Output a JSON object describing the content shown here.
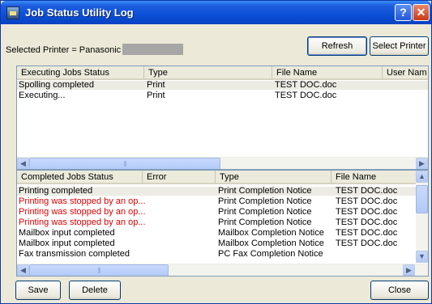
{
  "window": {
    "title": "Job Status Utility Log",
    "help_glyph": "?",
    "close_glyph": "✕"
  },
  "printer": {
    "label": "Selected Printer = Panasonic"
  },
  "buttons": {
    "refresh": "Refresh",
    "select_printer": "Select Printer",
    "save": "Save",
    "delete": "Delete",
    "close": "Close"
  },
  "executing": {
    "columns": [
      "Executing Jobs Status",
      "Type",
      "File Name",
      "User Nam"
    ],
    "rows": [
      [
        "Spolling completed",
        "Print",
        "TEST DOC.doc",
        ""
      ],
      [
        "Executing...",
        "Print",
        "TEST DOC.doc",
        ""
      ]
    ]
  },
  "completed": {
    "columns": [
      "Completed Jobs Status",
      "Error",
      "Type",
      "File Name"
    ],
    "rows": [
      [
        "Printing completed",
        "",
        "Print Completion Notice",
        "TEST DOC.doc"
      ],
      [
        "Printing was stopped by an op...",
        "",
        "Print Completion Notice",
        "TEST DOC.doc"
      ],
      [
        "Printing was stopped by an op...",
        "",
        "Print Completion Notice",
        "TEST DOC.doc"
      ],
      [
        "Printing was stopped by an op...",
        "",
        "Print Completion Notice",
        "TEST DOC.doc"
      ],
      [
        "Mailbox input completed",
        "",
        "Mailbox Completion Notice",
        "TEST DOC.doc"
      ],
      [
        "Mailbox input completed",
        "",
        "Mailbox Completion Notice",
        "TEST DOC.doc"
      ],
      [
        "Fax transmission completed",
        "",
        "PC Fax Completion Notice",
        ""
      ]
    ]
  },
  "colors": {
    "title_bar": "#0a4fd6",
    "stopped_text": "#e00000",
    "face": "#ece9d8"
  },
  "icons": {
    "scroll_left": "◀",
    "scroll_right": "▶",
    "scroll_up": "▲",
    "scroll_down": "▼",
    "grip": "|||"
  }
}
